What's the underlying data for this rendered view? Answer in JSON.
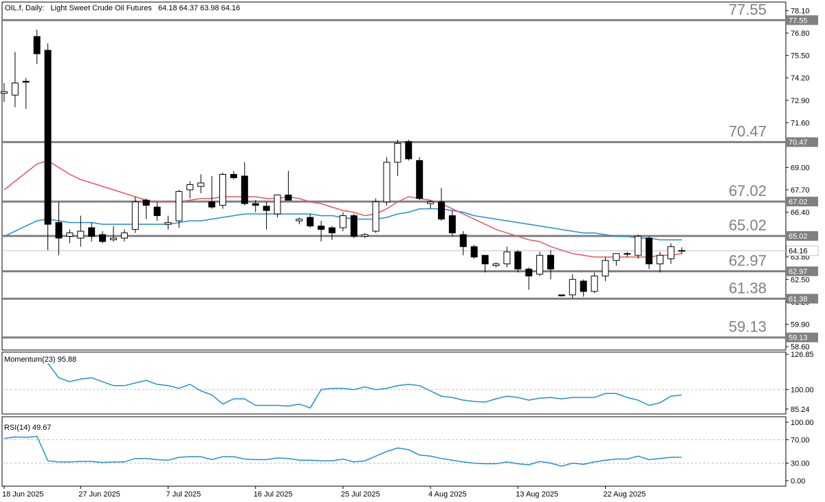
{
  "header": {
    "symbol": "OIL.f, Daily:",
    "name": "Light Sweet Crude Oil Futures",
    "ohlc": "64.18 64.37 63.98 64.16"
  },
  "colors": {
    "background": "#ffffff",
    "frame": "#000000",
    "level_line": "#808080",
    "ma_fast": "#e8555a",
    "ma_slow": "#1f8fd6",
    "indicator_line": "#1f8fd6",
    "bull_fill": "#ffffff",
    "bear_fill": "#000000",
    "price_tag": "#808080"
  },
  "price_axis": {
    "ticks": [
      "78.10",
      "76.80",
      "75.50",
      "74.20",
      "72.90",
      "71.60",
      "69.00",
      "67.70",
      "66.40",
      "63.80",
      "62.50",
      "61.20",
      "59.90",
      "58.60"
    ],
    "current_price": "64.16"
  },
  "levels": [
    {
      "value": 77.55,
      "label": "77.55",
      "tag": "77.55"
    },
    {
      "value": 70.47,
      "label": "70.47",
      "tag": "70.47"
    },
    {
      "value": 67.02,
      "label": "67.02",
      "tag": "67.02"
    },
    {
      "value": 65.02,
      "label": "65.02",
      "tag": "65.02"
    },
    {
      "value": 62.97,
      "label": "62.97",
      "tag": "62.97"
    },
    {
      "value": 61.38,
      "label": "61.38",
      "tag": "61.38"
    },
    {
      "value": 59.13,
      "label": "59.13",
      "tag": "59.13"
    }
  ],
  "momentum": {
    "label": "Momentum(23) 95.88",
    "ticks": [
      "126.85",
      "100.00",
      "85.24"
    ]
  },
  "rsi": {
    "label": "RSI(14) 49.67",
    "ticks": [
      "100.00",
      "70.00",
      "30.00",
      "0.00"
    ]
  },
  "x_axis": {
    "labels": [
      "18 Jun 2025",
      "27 Jun 2025",
      "7 Jul 2025",
      "16 Jul 2025",
      "25 Jul 2025",
      "4 Aug 2025",
      "13 Aug 2025",
      "22 Aug 2025"
    ]
  },
  "chart_data": {
    "type": "candlestick",
    "title": "OIL.f, Daily: Light Sweet Crude Oil Futures",
    "ylim": [
      58.4,
      78.6
    ],
    "candles": [
      {
        "o": 73.3,
        "h": 73.9,
        "l": 72.8,
        "c": 73.4
      },
      {
        "o": 73.2,
        "h": 75.7,
        "l": 72.5,
        "c": 73.9
      },
      {
        "o": 74.0,
        "h": 74.2,
        "l": 72.4,
        "c": 73.95
      },
      {
        "o": 76.6,
        "h": 77.0,
        "l": 75.0,
        "c": 75.6
      },
      {
        "o": 75.8,
        "h": 76.2,
        "l": 64.2,
        "c": 65.7
      },
      {
        "o": 65.8,
        "h": 67.0,
        "l": 63.9,
        "c": 64.9
      },
      {
        "o": 65.0,
        "h": 65.4,
        "l": 64.6,
        "c": 65.2
      },
      {
        "o": 64.9,
        "h": 66.2,
        "l": 64.4,
        "c": 65.3
      },
      {
        "o": 65.5,
        "h": 65.8,
        "l": 64.7,
        "c": 65.0
      },
      {
        "o": 65.1,
        "h": 65.3,
        "l": 64.6,
        "c": 64.7
      },
      {
        "o": 64.8,
        "h": 65.6,
        "l": 64.7,
        "c": 64.9
      },
      {
        "o": 64.9,
        "h": 65.4,
        "l": 64.7,
        "c": 65.2
      },
      {
        "o": 65.4,
        "h": 67.3,
        "l": 65.2,
        "c": 67.0
      },
      {
        "o": 67.1,
        "h": 67.2,
        "l": 66.0,
        "c": 66.8
      },
      {
        "o": 66.7,
        "h": 67.0,
        "l": 65.9,
        "c": 66.2
      },
      {
        "o": 65.7,
        "h": 66.2,
        "l": 65.4,
        "c": 65.8
      },
      {
        "o": 65.9,
        "h": 67.7,
        "l": 65.5,
        "c": 67.6
      },
      {
        "o": 67.7,
        "h": 68.2,
        "l": 67.2,
        "c": 68.0
      },
      {
        "o": 67.9,
        "h": 68.6,
        "l": 67.5,
        "c": 68.1
      },
      {
        "o": 67.0,
        "h": 68.5,
        "l": 66.6,
        "c": 66.7
      },
      {
        "o": 66.8,
        "h": 68.7,
        "l": 66.6,
        "c": 68.6
      },
      {
        "o": 68.6,
        "h": 68.8,
        "l": 68.3,
        "c": 68.4
      },
      {
        "o": 68.5,
        "h": 69.3,
        "l": 66.8,
        "c": 66.9
      },
      {
        "o": 66.9,
        "h": 67.1,
        "l": 66.4,
        "c": 66.8
      },
      {
        "o": 66.75,
        "h": 67.0,
        "l": 65.4,
        "c": 66.5
      },
      {
        "o": 66.3,
        "h": 67.3,
        "l": 66.1,
        "c": 67.4
      },
      {
        "o": 67.4,
        "h": 68.8,
        "l": 67.1,
        "c": 67.1
      },
      {
        "o": 65.9,
        "h": 66.1,
        "l": 65.7,
        "c": 66.0
      },
      {
        "o": 66.1,
        "h": 66.3,
        "l": 65.5,
        "c": 65.6
      },
      {
        "o": 65.6,
        "h": 65.9,
        "l": 64.7,
        "c": 65.4
      },
      {
        "o": 65.5,
        "h": 65.6,
        "l": 64.8,
        "c": 65.2
      },
      {
        "o": 65.5,
        "h": 66.4,
        "l": 65.3,
        "c": 66.2
      },
      {
        "o": 66.2,
        "h": 66.3,
        "l": 64.9,
        "c": 65.0
      },
      {
        "o": 65.0,
        "h": 65.2,
        "l": 64.9,
        "c": 65.1
      },
      {
        "o": 65.3,
        "h": 67.2,
        "l": 65.2,
        "c": 67.0
      },
      {
        "o": 67.0,
        "h": 69.6,
        "l": 66.8,
        "c": 69.3
      },
      {
        "o": 69.3,
        "h": 70.6,
        "l": 68.5,
        "c": 70.4
      },
      {
        "o": 70.5,
        "h": 70.6,
        "l": 69.4,
        "c": 69.5
      },
      {
        "o": 69.4,
        "h": 69.6,
        "l": 67.1,
        "c": 67.2
      },
      {
        "o": 66.9,
        "h": 67.1,
        "l": 66.6,
        "c": 67.0
      },
      {
        "o": 67.0,
        "h": 67.8,
        "l": 65.9,
        "c": 66.0
      },
      {
        "o": 66.2,
        "h": 66.5,
        "l": 65.0,
        "c": 65.2
      },
      {
        "o": 65.1,
        "h": 65.3,
        "l": 63.9,
        "c": 64.4
      },
      {
        "o": 64.4,
        "h": 64.5,
        "l": 63.7,
        "c": 63.8
      },
      {
        "o": 63.9,
        "h": 63.9,
        "l": 62.9,
        "c": 63.4
      },
      {
        "o": 63.3,
        "h": 63.5,
        "l": 63.2,
        "c": 63.4
      },
      {
        "o": 63.4,
        "h": 64.4,
        "l": 63.2,
        "c": 64.1
      },
      {
        "o": 64.1,
        "h": 64.2,
        "l": 62.9,
        "c": 63.1
      },
      {
        "o": 63.1,
        "h": 63.2,
        "l": 61.9,
        "c": 62.7
      },
      {
        "o": 62.8,
        "h": 64.1,
        "l": 62.7,
        "c": 63.9
      },
      {
        "o": 63.9,
        "h": 64.2,
        "l": 62.5,
        "c": 63.1
      },
      {
        "o": 61.6,
        "h": 61.6,
        "l": 61.5,
        "c": 61.55
      },
      {
        "o": 61.6,
        "h": 62.8,
        "l": 61.4,
        "c": 62.5
      },
      {
        "o": 62.4,
        "h": 62.5,
        "l": 61.5,
        "c": 61.8
      },
      {
        "o": 61.8,
        "h": 62.9,
        "l": 61.7,
        "c": 62.7
      },
      {
        "o": 62.7,
        "h": 63.8,
        "l": 62.4,
        "c": 63.6
      },
      {
        "o": 63.6,
        "h": 64.0,
        "l": 63.3,
        "c": 64.0
      },
      {
        "o": 64.0,
        "h": 64.1,
        "l": 63.8,
        "c": 64.0
      },
      {
        "o": 63.9,
        "h": 65.1,
        "l": 63.7,
        "c": 65.0
      },
      {
        "o": 64.9,
        "h": 65.0,
        "l": 63.1,
        "c": 63.4
      },
      {
        "o": 63.4,
        "h": 64.1,
        "l": 62.9,
        "c": 63.9
      },
      {
        "o": 63.7,
        "h": 64.6,
        "l": 63.4,
        "c": 64.4
      },
      {
        "o": 64.18,
        "h": 64.37,
        "l": 63.98,
        "c": 64.16
      }
    ],
    "ma_fast": [
      67.7,
      68.2,
      68.7,
      69.2,
      69.4,
      69.0,
      68.6,
      68.3,
      68.1,
      67.9,
      67.7,
      67.5,
      67.3,
      67.1,
      67.0,
      67.0,
      67.0,
      67.1,
      67.2,
      67.2,
      67.3,
      67.3,
      67.3,
      67.3,
      67.2,
      67.2,
      67.3,
      67.2,
      67.0,
      66.9,
      66.7,
      66.5,
      66.4,
      66.2,
      66.3,
      66.6,
      67.0,
      67.3,
      67.2,
      67.1,
      66.9,
      66.6,
      66.3,
      66.0,
      65.7,
      65.4,
      65.2,
      65.0,
      64.8,
      64.7,
      64.4,
      64.2,
      64.0,
      63.9,
      63.8,
      63.8,
      63.8,
      63.8,
      63.8,
      63.8,
      63.9,
      63.9,
      64.0
    ],
    "ma_slow": [
      65.0,
      65.3,
      65.6,
      65.9,
      66.0,
      65.9,
      65.8,
      65.8,
      65.8,
      65.7,
      65.7,
      65.7,
      65.7,
      65.7,
      65.7,
      65.7,
      65.8,
      65.9,
      65.9,
      66.0,
      66.1,
      66.2,
      66.3,
      66.3,
      66.3,
      66.3,
      66.3,
      66.3,
      66.3,
      66.2,
      66.2,
      66.1,
      66.0,
      66.0,
      66.0,
      66.1,
      66.3,
      66.4,
      66.6,
      66.6,
      66.6,
      66.5,
      66.4,
      66.2,
      66.1,
      66.0,
      65.9,
      65.8,
      65.7,
      65.6,
      65.5,
      65.4,
      65.3,
      65.2,
      65.2,
      65.1,
      65.0,
      65.0,
      64.9,
      64.9,
      64.8,
      64.8,
      64.8
    ],
    "momentum_values": [
      null,
      null,
      null,
      null,
      120.0,
      109.0,
      106.0,
      108.0,
      109.0,
      106.0,
      103.0,
      103.0,
      105.0,
      107.0,
      104.0,
      103.0,
      101.0,
      104.0,
      99.0,
      96.0,
      89.0,
      93.0,
      93.0,
      88.0,
      88.0,
      88.0,
      87.5,
      89.0,
      86.0,
      100.0,
      101.0,
      101.0,
      100.0,
      102.0,
      100.0,
      101.0,
      103.0,
      104.0,
      103.0,
      99.0,
      95.0,
      94.0,
      92.0,
      91.0,
      90.5,
      93.0,
      95.0,
      94.0,
      92.0,
      93.5,
      94.0,
      93.0,
      94.0,
      94.0,
      94.0,
      97.0,
      97.0,
      94.0,
      92.0,
      88.0,
      90.0,
      95.0,
      95.9
    ],
    "rsi_values": [
      72.0,
      75.0,
      74.0,
      76.0,
      34.0,
      32.0,
      32.0,
      33.0,
      33.0,
      31.0,
      32.0,
      32.0,
      38.0,
      38.0,
      36.0,
      35.0,
      40.0,
      41.0,
      41.0,
      36.0,
      41.0,
      41.0,
      37.0,
      36.0,
      36.0,
      39.0,
      38.0,
      35.0,
      35.0,
      34.0,
      34.0,
      37.0,
      32.0,
      34.0,
      42.0,
      50.0,
      56.0,
      53.0,
      44.0,
      42.0,
      38.0,
      35.0,
      32.0,
      30.0,
      29.0,
      29.0,
      32.0,
      29.0,
      27.0,
      33.0,
      30.0,
      25.0,
      30.0,
      28.0,
      32.0,
      35.0,
      37.0,
      37.0,
      42.0,
      36.0,
      38.0,
      40.0,
      40.0
    ]
  }
}
